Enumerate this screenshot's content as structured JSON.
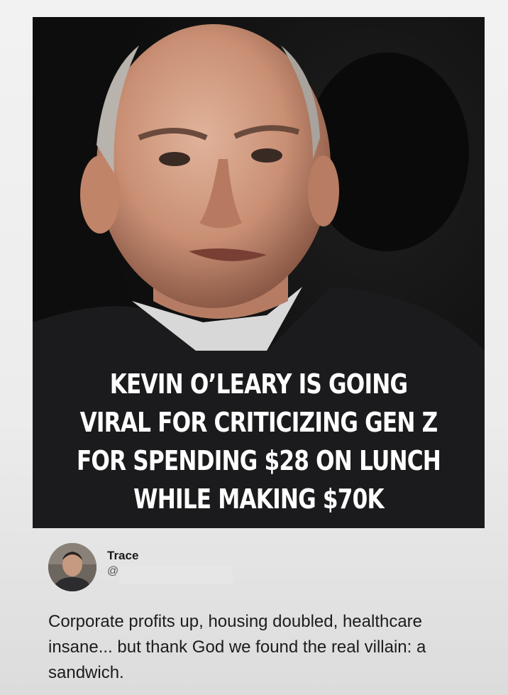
{
  "headline": {
    "lines": [
      "KEVIN O’LEARY IS GOING",
      "VIRAL FOR CRITICIZING GEN Z",
      "FOR SPENDING $28 ON LUNCH",
      "WHILE MAKING $70K"
    ]
  },
  "tweet": {
    "author_name": "Trace",
    "author_handle": "@",
    "text": "Corporate profits up, housing doubled, healthcare insane... but thank God we found the real villain: a sandwich."
  },
  "colors": {
    "image_background": "#141414",
    "headline_text": "#ffffff",
    "page_background": "#efefef",
    "tweet_text": "#1c1c1c"
  }
}
